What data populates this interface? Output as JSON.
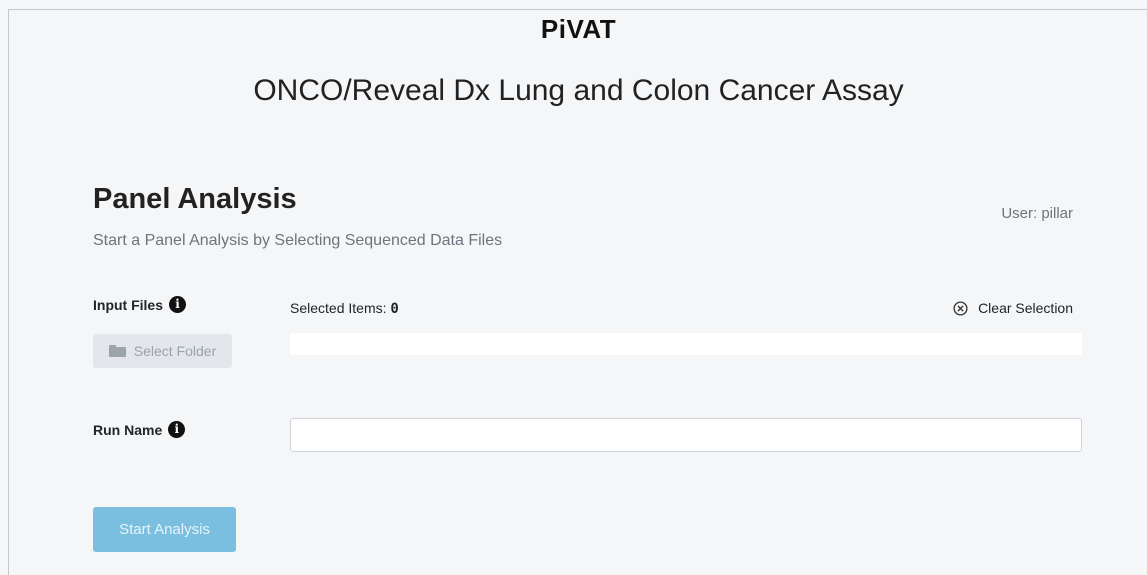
{
  "header": {
    "brand": "PiVAT",
    "assay_title": "ONCO/Reveal Dx Lung and Colon Cancer Assay"
  },
  "panel": {
    "title": "Panel Analysis",
    "subtitle": "Start a Panel Analysis by Selecting Sequenced Data Files",
    "user_label": "User: pillar"
  },
  "input_files": {
    "label": "Input Files",
    "info_icon": "i",
    "select_folder_label": "Select Folder",
    "selected_items_label": "Selected Items:",
    "selected_items_count": "0",
    "clear_selection_label": "Clear Selection"
  },
  "run_name": {
    "label": "Run Name",
    "info_icon": "i",
    "value": "",
    "placeholder": ""
  },
  "actions": {
    "start_analysis_label": "Start Analysis"
  },
  "icons": {
    "info": "info-icon",
    "folder": "folder-icon",
    "clear": "circle-x-icon"
  },
  "colors": {
    "background": "#f5f6f8",
    "start_button": "#7bbfe0",
    "disabled_button": "#e3e6ea",
    "muted_text": "#6c757d"
  }
}
